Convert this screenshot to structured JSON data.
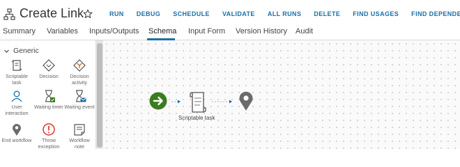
{
  "header": {
    "title": "Create Link",
    "actions": [
      "RUN",
      "DEBUG",
      "SCHEDULE",
      "VALIDATE",
      "ALL RUNS",
      "DELETE",
      "FIND USAGES",
      "FIND DEPENDENCIES"
    ]
  },
  "tabs": [
    "Summary",
    "Variables",
    "Inputs/Outputs",
    "Schema",
    "Input Form",
    "Version History",
    "Audit"
  ],
  "active_tab": "Schema",
  "palette": {
    "group": "Generic",
    "items": [
      {
        "label": "Scriptable task",
        "icon": "scriptable-task-icon"
      },
      {
        "label": "Decision",
        "icon": "decision-icon"
      },
      {
        "label": "Decision activity",
        "icon": "decision-activity-icon"
      },
      {
        "label": "User interaction",
        "icon": "user-interaction-icon"
      },
      {
        "label": "Waiting timer",
        "icon": "waiting-timer-icon"
      },
      {
        "label": "Waiting event",
        "icon": "waiting-event-icon"
      },
      {
        "label": "End workflow",
        "icon": "end-workflow-icon"
      },
      {
        "label": "Throw exception",
        "icon": "throw-exception-icon"
      },
      {
        "label": "Workflow note",
        "icon": "workflow-note-icon"
      }
    ]
  },
  "canvas": {
    "nodes": [
      {
        "type": "start",
        "icon": "start-arrow-icon"
      },
      {
        "type": "scriptable-task",
        "label": "Scriptable task",
        "icon": "scriptable-task-icon"
      },
      {
        "type": "end",
        "icon": "end-workflow-icon"
      }
    ]
  },
  "colors": {
    "accent": "#1a6fa8",
    "start": "#3a7d1e",
    "end": "#6b6b6b",
    "exception": "#d6342c"
  }
}
